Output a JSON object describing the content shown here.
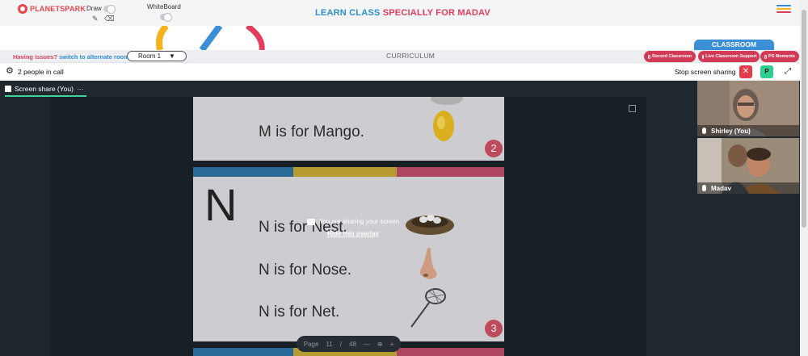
{
  "brand": {
    "logo_text": "PLANETSPARK"
  },
  "tools": {
    "draw_label": "Draw",
    "whiteboard_label": "WhiteBoard"
  },
  "title": {
    "part1": "LEARN CLASS",
    "part2": "SPECIALLY FOR MADAV"
  },
  "roombar": {
    "issues_text": "Having issues?",
    "alternate_link": "switch to alternate room",
    "room_value": "Room 1",
    "curriculum": "CURRICULUM"
  },
  "classroom_tab": "CLASSROOM",
  "pills": {
    "record": "Record Classroom",
    "support": "Live Classroom Support",
    "moments": "PS Moments"
  },
  "call": {
    "people_text": "2 people in call",
    "stop_sharing": "Stop screen sharing",
    "avatar_initial": "P"
  },
  "share_tab": {
    "label": "Screen share (You)",
    "more": "···"
  },
  "slides": {
    "s1_line": "M is for Mango.",
    "s1_badge": "2",
    "big_letter": "N",
    "s2_lines": [
      "N is for Nest.",
      "N is for Nose.",
      "N is for Net."
    ],
    "s2_badge": "3"
  },
  "overlay": {
    "message": "You are sharing your screen",
    "hide": "Hide this overlay"
  },
  "pager": {
    "label": "Page",
    "current": "11",
    "separator": "/",
    "total": "48",
    "minus": "—",
    "plus": "+"
  },
  "participants": [
    {
      "name": "Shirley (You)"
    },
    {
      "name": "Madav"
    }
  ],
  "colors": {
    "brand_red": "#e8464b",
    "title_blue": "#2f8fd1",
    "title_pink": "#e33d5d",
    "pill_red": "#d23a55",
    "classroom_blue": "#3b8fd6",
    "stage_dark": "#1f282f",
    "slide_bg": "#d9d9dc",
    "bar_blue": "#2b6fa0",
    "bar_yellow": "#c3a432",
    "bar_pink": "#b84a64",
    "badge": "#c94f5f",
    "accent_green": "#3ed39a"
  },
  "icons": {
    "settings": "gear-icon",
    "close": "close-icon",
    "expand": "expand-icon",
    "pencil": "pencil-icon",
    "eraser": "eraser-icon",
    "menu": "hamburger-icon",
    "mic": "mic-icon",
    "share": "screen-share-icon",
    "popout": "popout-icon",
    "zoom_in": "zoom-in-icon"
  }
}
